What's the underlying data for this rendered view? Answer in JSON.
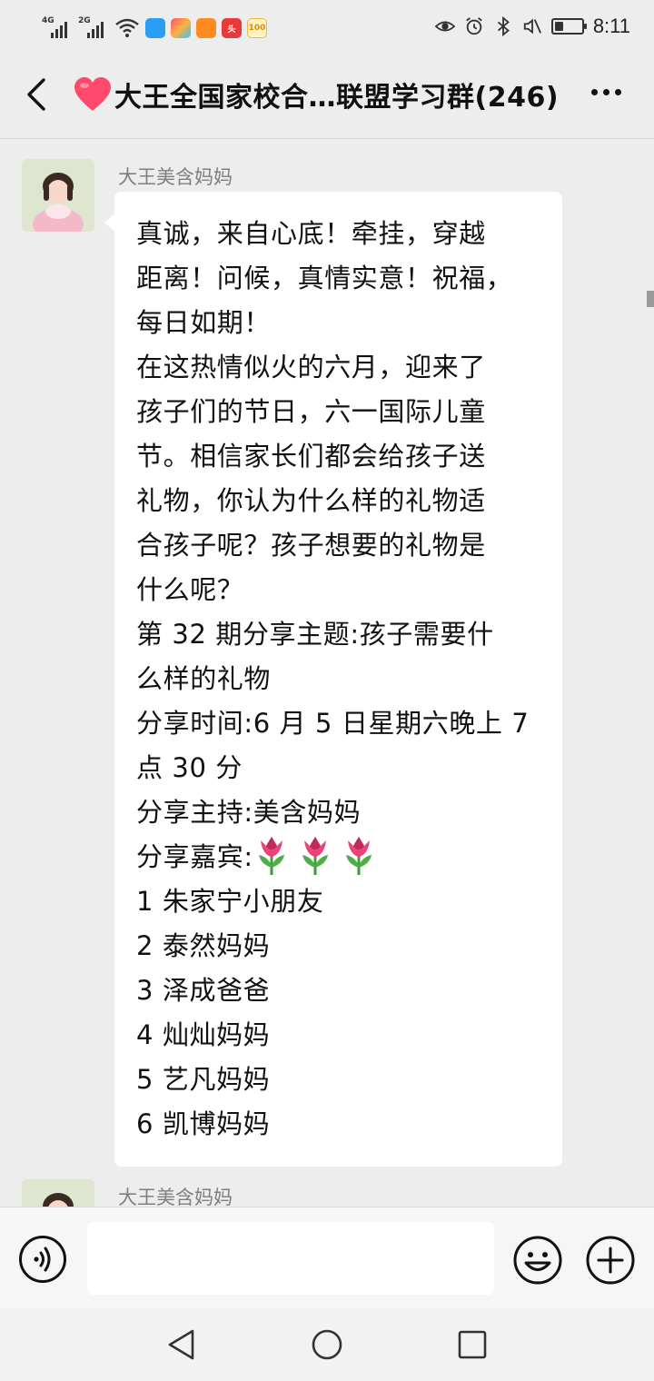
{
  "status_bar": {
    "signal_1": "4G",
    "signal_2": "2G",
    "time": "8:11",
    "battery_level": 0.3
  },
  "header": {
    "title": "大王全国家校合…联盟学习群(246)"
  },
  "messages": [
    {
      "sender": "大王美含妈妈",
      "lines": [
        "真诚，来自心底！牵挂，穿越",
        "距离！问候，真情实意！祝福，",
        "每日如期！",
        "在这热情似火的六月，迎来了",
        "孩子们的节日，六一国际儿童",
        "节。相信家长们都会给孩子送",
        "礼物，你认为什么样的礼物适",
        "合孩子呢？孩子想要的礼物是",
        "什么呢？",
        "第 32 期分享主题:孩子需要什",
        "么样的礼物",
        "分享时间:6 月 5 日星期六晚上 7",
        "点 30 分",
        "分享主持:美含妈妈",
        "分享嘉宾:",
        "1 朱家宁小朋友",
        "2 泰然妈妈",
        "3 泽成爸爸",
        "4 灿灿妈妈",
        "5 艺凡妈妈",
        "6 凯博妈妈"
      ]
    },
    {
      "sender": "大王美含妈妈"
    }
  ],
  "input": {
    "value": ""
  },
  "icons": {
    "back": "back-arrow-icon",
    "more": "more-dots-icon",
    "voice": "voice-icon",
    "emoji": "emoji-icon",
    "plus": "plus-icon",
    "nav_back": "nav-back-icon",
    "nav_home": "nav-home-icon",
    "nav_recent": "nav-recent-icon",
    "decoration": "tulip-icon"
  },
  "colors": {
    "background": "#ededed",
    "bubble": "#ffffff",
    "sender_name": "#7f7f7f",
    "heart": "#ff4a6e"
  }
}
